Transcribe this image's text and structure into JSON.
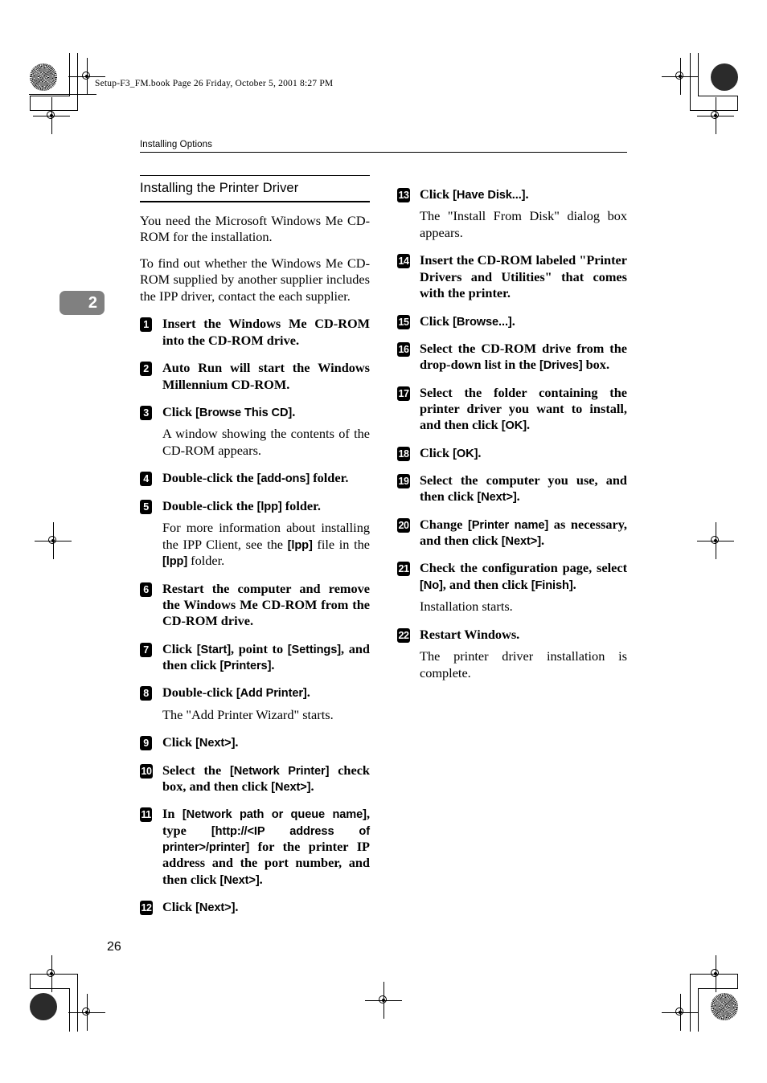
{
  "printer_marks": {
    "file_line": "Setup-F3_FM.book  Page 26  Friday, October 5, 2001  8:27 PM"
  },
  "page": {
    "running_header": "Installing Options",
    "chapter_tab": "2",
    "page_number": "26"
  },
  "left_column": {
    "section_heading": "Installing the Printer Driver",
    "intro_paragraphs": [
      "You need the Microsoft Windows Me CD-ROM for the installation.",
      "To find out whether the Windows Me CD-ROM supplied by another supplier includes the IPP driver, contact the each supplier."
    ],
    "steps": [
      {
        "number": "1",
        "parts": [
          {
            "type": "text",
            "value": "Insert the Windows Me CD-ROM into the CD-ROM drive."
          }
        ],
        "note": ""
      },
      {
        "number": "2",
        "parts": [
          {
            "type": "text",
            "value": "Auto Run will start the Windows Millennium CD-ROM."
          }
        ],
        "note": ""
      },
      {
        "number": "3",
        "parts": [
          {
            "type": "text",
            "value": "Click "
          },
          {
            "type": "ui",
            "value": "[Browse This CD]"
          },
          {
            "type": "text",
            "value": "."
          }
        ],
        "note": "A window showing the contents of the CD-ROM appears."
      },
      {
        "number": "4",
        "parts": [
          {
            "type": "text",
            "value": "Double-click the "
          },
          {
            "type": "ui",
            "value": "[add-ons]"
          },
          {
            "type": "text",
            "value": " folder."
          }
        ],
        "note": ""
      },
      {
        "number": "5",
        "parts": [
          {
            "type": "text",
            "value": "Double-click the "
          },
          {
            "type": "ui",
            "value": "[lpp]"
          },
          {
            "type": "text",
            "value": " folder."
          }
        ],
        "note_parts": [
          {
            "type": "text",
            "value": "For more information about installing the IPP Client, see the "
          },
          {
            "type": "ui",
            "value": "[lpp]"
          },
          {
            "type": "text",
            "value": " file in the "
          },
          {
            "type": "ui",
            "value": "[lpp]"
          },
          {
            "type": "text",
            "value": " folder."
          }
        ]
      },
      {
        "number": "6",
        "parts": [
          {
            "type": "text",
            "value": "Restart the computer and remove the Windows Me CD-ROM from the CD-ROM drive."
          }
        ],
        "note": ""
      },
      {
        "number": "7",
        "parts": [
          {
            "type": "text",
            "value": "Click "
          },
          {
            "type": "ui",
            "value": "[Start]"
          },
          {
            "type": "text",
            "value": ", point to "
          },
          {
            "type": "ui",
            "value": "[Settings]"
          },
          {
            "type": "text",
            "value": ", and then click "
          },
          {
            "type": "ui",
            "value": "[Printers]"
          },
          {
            "type": "text",
            "value": "."
          }
        ],
        "note": ""
      },
      {
        "number": "8",
        "parts": [
          {
            "type": "text",
            "value": "Double-click "
          },
          {
            "type": "ui",
            "value": "[Add Printer]"
          },
          {
            "type": "text",
            "value": "."
          }
        ],
        "note": "The \"Add Printer Wizard\" starts."
      },
      {
        "number": "9",
        "parts": [
          {
            "type": "text",
            "value": "Click "
          },
          {
            "type": "ui",
            "value": "[Next>]"
          },
          {
            "type": "text",
            "value": "."
          }
        ],
        "note": ""
      },
      {
        "number": "10",
        "parts": [
          {
            "type": "text",
            "value": "Select the "
          },
          {
            "type": "ui",
            "value": "[Network Printer]"
          },
          {
            "type": "text",
            "value": " check box, and then click "
          },
          {
            "type": "ui",
            "value": "[Next>]"
          },
          {
            "type": "text",
            "value": "."
          }
        ],
        "note": ""
      },
      {
        "number": "11",
        "parts": [
          {
            "type": "text",
            "value": "In "
          },
          {
            "type": "ui",
            "value": "[Network path or queue name]"
          },
          {
            "type": "text",
            "value": ", type "
          },
          {
            "type": "ui",
            "value": "[http://<IP address of printer>/printer]"
          },
          {
            "type": "text",
            "value": " for the printer IP address and the port number, and then click "
          },
          {
            "type": "ui",
            "value": "[Next>]"
          },
          {
            "type": "text",
            "value": "."
          }
        ],
        "note": ""
      },
      {
        "number": "12",
        "parts": [
          {
            "type": "text",
            "value": "Click "
          },
          {
            "type": "ui",
            "value": "[Next>]"
          },
          {
            "type": "text",
            "value": "."
          }
        ],
        "note": ""
      }
    ]
  },
  "right_column": {
    "steps": [
      {
        "number": "13",
        "parts": [
          {
            "type": "text",
            "value": "Click "
          },
          {
            "type": "ui",
            "value": "[Have Disk...]"
          },
          {
            "type": "text",
            "value": "."
          }
        ],
        "note": "The \"Install From Disk\" dialog box appears."
      },
      {
        "number": "14",
        "parts": [
          {
            "type": "text",
            "value": "Insert the CD-ROM labeled \"Printer Drivers and Utilities\" that comes with the printer."
          }
        ],
        "note": ""
      },
      {
        "number": "15",
        "parts": [
          {
            "type": "text",
            "value": "Click "
          },
          {
            "type": "ui",
            "value": "[Browse...]"
          },
          {
            "type": "text",
            "value": "."
          }
        ],
        "note": ""
      },
      {
        "number": "16",
        "parts": [
          {
            "type": "text",
            "value": "Select the CD-ROM drive from the drop-down list in the "
          },
          {
            "type": "ui",
            "value": "[Drives]"
          },
          {
            "type": "text",
            "value": " box."
          }
        ],
        "note": ""
      },
      {
        "number": "17",
        "parts": [
          {
            "type": "text",
            "value": "Select the folder containing the printer driver you want to install, and then click "
          },
          {
            "type": "ui",
            "value": "[OK]"
          },
          {
            "type": "text",
            "value": "."
          }
        ],
        "note": ""
      },
      {
        "number": "18",
        "parts": [
          {
            "type": "text",
            "value": "Click "
          },
          {
            "type": "ui",
            "value": "[OK]"
          },
          {
            "type": "text",
            "value": "."
          }
        ],
        "note": ""
      },
      {
        "number": "19",
        "parts": [
          {
            "type": "text",
            "value": "Select the computer you use, and then click "
          },
          {
            "type": "ui",
            "value": "[Next>]"
          },
          {
            "type": "text",
            "value": "."
          }
        ],
        "note": ""
      },
      {
        "number": "20",
        "parts": [
          {
            "type": "text",
            "value": "Change "
          },
          {
            "type": "ui",
            "value": "[Printer name]"
          },
          {
            "type": "text",
            "value": " as necessary, and then click "
          },
          {
            "type": "ui",
            "value": "[Next>]"
          },
          {
            "type": "text",
            "value": "."
          }
        ],
        "note": ""
      },
      {
        "number": "21",
        "parts": [
          {
            "type": "text",
            "value": "Check the configuration page, select "
          },
          {
            "type": "ui",
            "value": "[No]"
          },
          {
            "type": "text",
            "value": ", and then click "
          },
          {
            "type": "ui",
            "value": "[Finish]"
          },
          {
            "type": "text",
            "value": "."
          }
        ],
        "note": "Installation starts."
      },
      {
        "number": "22",
        "parts": [
          {
            "type": "text",
            "value": "Restart Windows."
          }
        ],
        "note": "The printer driver installation is complete."
      }
    ]
  }
}
